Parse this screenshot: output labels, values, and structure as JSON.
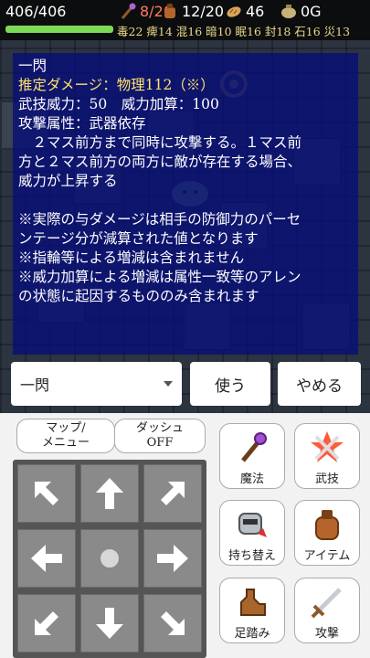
{
  "status": {
    "hp": "406/406",
    "hp_fraction": 1.0,
    "wand": "8/20",
    "bag": "12/20",
    "bread": "46",
    "gold": "0G",
    "resistances": "毒22 痺14 混16 暗10 眠16 封18 石16 災13"
  },
  "info": {
    "name": "一閃",
    "damage": "推定ダメージ：物理112（※）",
    "power": "武技威力：50　威力加算：100",
    "attribute": "攻撃属性：武器依存",
    "desc1": "　２マス前方まで同時に攻撃する。１マス前",
    "desc2": "方と２マス前方の両方に敵が存在する場合、",
    "desc3": "威力が上昇する",
    "note1": "※実際の与ダメージは相手の防御力のパーセ",
    "note2": "ンテージ分が減算された値となります",
    "note3": "※指輪等による増減は含まれません",
    "note4": "※威力加算による増減は属性一致等のアレン",
    "note5": "の状態に起因するもののみ含まれます"
  },
  "actions": {
    "selected_skill": "一閃",
    "use_label": "使う",
    "quit_label": "やめる"
  },
  "controls": {
    "map_line1": "マップ/",
    "map_line2": "メニュー",
    "dash_line1": "ダッシュ",
    "dash_line2": "OFF",
    "magic": "魔法",
    "skill": "武技",
    "swap": "持ち替え",
    "item": "アイテム",
    "step": "足踏み",
    "attack": "攻撃"
  },
  "colors": {
    "wand_count": "#ff7a5c",
    "hp_bar": "#7ed957",
    "resist_text": "#e8d88a",
    "panel": "#080e78",
    "highlight": "#ffe26a"
  },
  "icons": [
    "wand-icon",
    "bag-icon",
    "bread-icon",
    "gold-icon",
    "magic-icon",
    "skill-icon",
    "swap-icon",
    "item-icon",
    "step-icon",
    "attack-icon"
  ]
}
